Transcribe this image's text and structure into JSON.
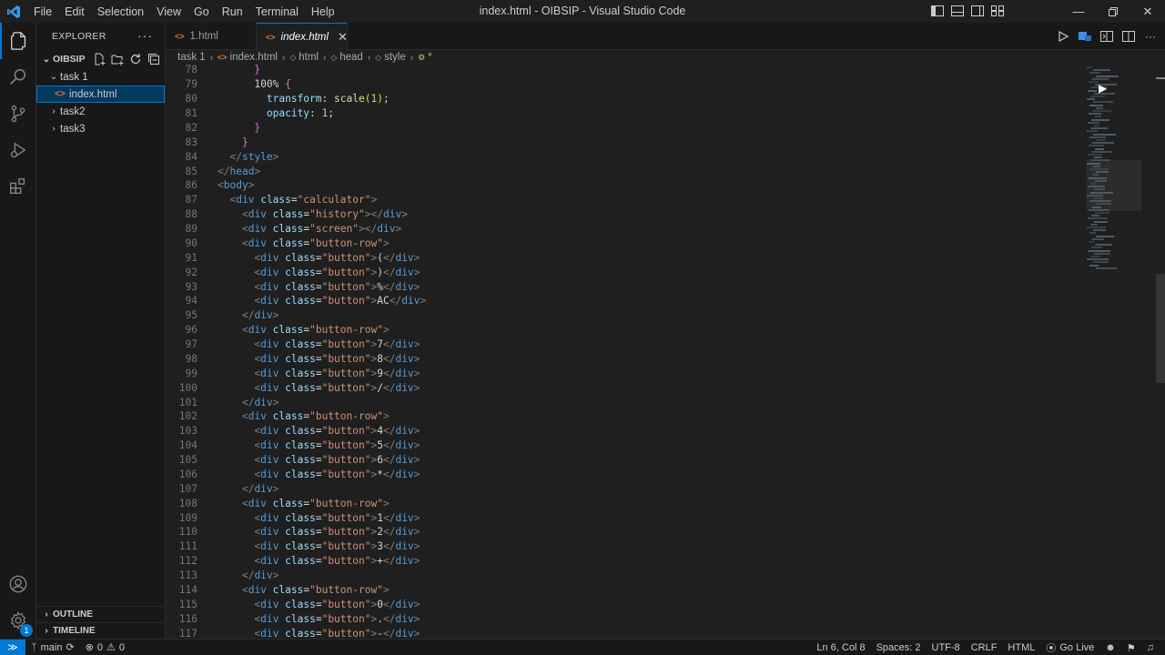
{
  "window": {
    "title": "index.html - OIBSIP - Visual Studio Code"
  },
  "menu": [
    "File",
    "Edit",
    "Selection",
    "View",
    "Go",
    "Run",
    "Terminal",
    "Help"
  ],
  "activity": {
    "extensions_badge": "1"
  },
  "sidebar": {
    "title": "EXPLORER",
    "more": "···",
    "root": "OIBSIP",
    "items": [
      {
        "label": "task 1",
        "type": "folder",
        "expanded": true,
        "depth": 1
      },
      {
        "label": "index.html",
        "type": "file",
        "depth": 2,
        "selected": true
      },
      {
        "label": "task2",
        "type": "folder",
        "expanded": false,
        "depth": 1
      },
      {
        "label": "task3",
        "type": "folder",
        "expanded": false,
        "depth": 1
      }
    ],
    "outline_label": "OUTLINE",
    "timeline_label": "TIMELINE"
  },
  "tabs": [
    {
      "label": "1.html",
      "active": false
    },
    {
      "label": "index.html",
      "active": true
    }
  ],
  "breadcrumb": [
    "task 1",
    "index.html",
    "html",
    "head",
    "style",
    "*"
  ],
  "code_lines": [
    {
      "n": "78",
      "text": "      }"
    },
    {
      "n": "79",
      "text": "      100% {"
    },
    {
      "n": "80",
      "text": "        transform: scale(1);"
    },
    {
      "n": "81",
      "text": "        opacity: 1;"
    },
    {
      "n": "82",
      "text": "      }"
    },
    {
      "n": "83",
      "text": "    }"
    },
    {
      "n": "84",
      "text": "  </style>"
    },
    {
      "n": "85",
      "text": "</head>"
    },
    {
      "n": "86",
      "text": "<body>"
    },
    {
      "n": "87",
      "text": "  <div class=\"calculator\">"
    },
    {
      "n": "88",
      "text": "    <div class=\"history\"></div>"
    },
    {
      "n": "89",
      "text": "    <div class=\"screen\"></div>"
    },
    {
      "n": "90",
      "text": "    <div class=\"button-row\">"
    },
    {
      "n": "91",
      "text": "      <div class=\"button\">(</div>"
    },
    {
      "n": "92",
      "text": "      <div class=\"button\">)</div>"
    },
    {
      "n": "93",
      "text": "      <div class=\"button\">%</div>"
    },
    {
      "n": "94",
      "text": "      <div class=\"button\">AC</div>"
    },
    {
      "n": "95",
      "text": "    </div>"
    },
    {
      "n": "96",
      "text": "    <div class=\"button-row\">"
    },
    {
      "n": "97",
      "text": "      <div class=\"button\">7</div>"
    },
    {
      "n": "98",
      "text": "      <div class=\"button\">8</div>"
    },
    {
      "n": "99",
      "text": "      <div class=\"button\">9</div>"
    },
    {
      "n": "100",
      "text": "      <div class=\"button\">/</div>"
    },
    {
      "n": "101",
      "text": "    </div>"
    },
    {
      "n": "102",
      "text": "    <div class=\"button-row\">"
    },
    {
      "n": "103",
      "text": "      <div class=\"button\">4</div>"
    },
    {
      "n": "104",
      "text": "      <div class=\"button\">5</div>"
    },
    {
      "n": "105",
      "text": "      <div class=\"button\">6</div>"
    },
    {
      "n": "106",
      "text": "      <div class=\"button\">*</div>"
    },
    {
      "n": "107",
      "text": "    </div>"
    },
    {
      "n": "108",
      "text": "    <div class=\"button-row\">"
    },
    {
      "n": "109",
      "text": "      <div class=\"button\">1</div>"
    },
    {
      "n": "110",
      "text": "      <div class=\"button\">2</div>"
    },
    {
      "n": "111",
      "text": "      <div class=\"button\">3</div>"
    },
    {
      "n": "112",
      "text": "      <div class=\"button\">+</div>"
    },
    {
      "n": "113",
      "text": "    </div>"
    },
    {
      "n": "114",
      "text": "    <div class=\"button-row\">"
    },
    {
      "n": "115",
      "text": "      <div class=\"button\">0</div>"
    },
    {
      "n": "116",
      "text": "      <div class=\"button\">.</div>"
    },
    {
      "n": "117",
      "text": "      <div class=\"button\">-</div>"
    }
  ],
  "statusbar": {
    "branch": "main",
    "errors": "0",
    "warnings": "0",
    "position": "Ln 6, Col 8",
    "spaces": "Spaces: 2",
    "encoding": "UTF-8",
    "eol": "CRLF",
    "language": "HTML",
    "golive": "Go Live"
  },
  "colors": {
    "accent": "#0078d4",
    "editor_bg": "#1f1f1f",
    "sidebar_bg": "#181818"
  }
}
